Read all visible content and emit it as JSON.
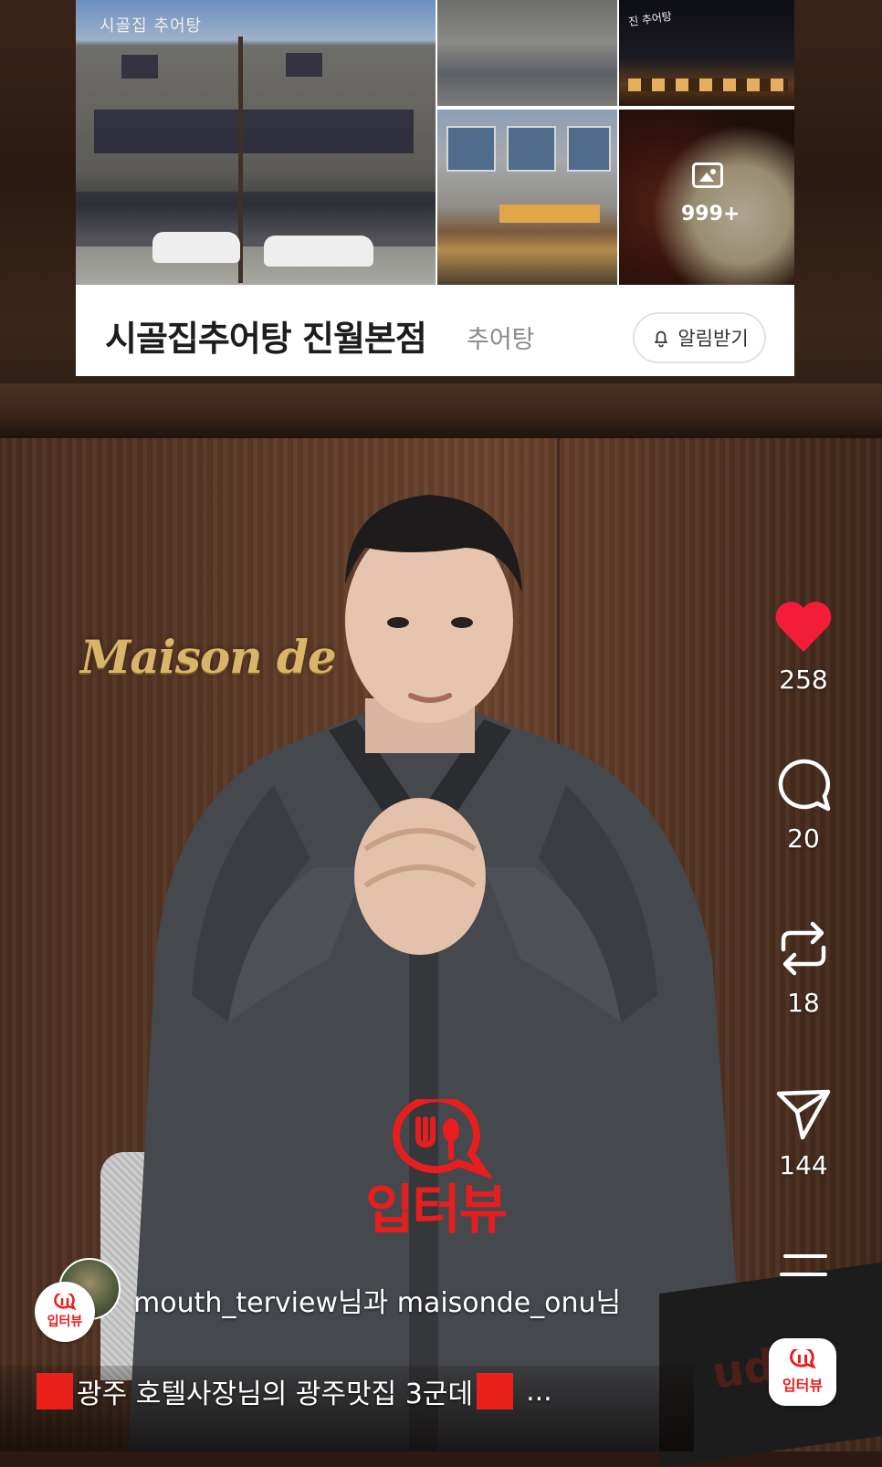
{
  "place_card": {
    "photo_sign": "시골집 추어탕",
    "night_sign": "진 추어탕",
    "more_photos": "999+",
    "name": "시골집추어탕 진월본점",
    "category": "추어탕",
    "notify_label": "알림받기"
  },
  "scene": {
    "wall_sign": "Maison de"
  },
  "watermark": {
    "text": "입터뷰"
  },
  "actions": {
    "like_count": "258",
    "comment_count": "20",
    "repost_count": "18",
    "share_count": "144"
  },
  "post": {
    "avatar_label": "입터뷰",
    "authors": "mouth_terview님과 maisonde_onu님",
    "caption": "광주 호텔사장님의 광주맛집 3군데",
    "caption_more": "...",
    "app_label": "입터뷰"
  },
  "colors": {
    "accent_red": "#e81e1e",
    "like_red": "#f31d3a"
  }
}
